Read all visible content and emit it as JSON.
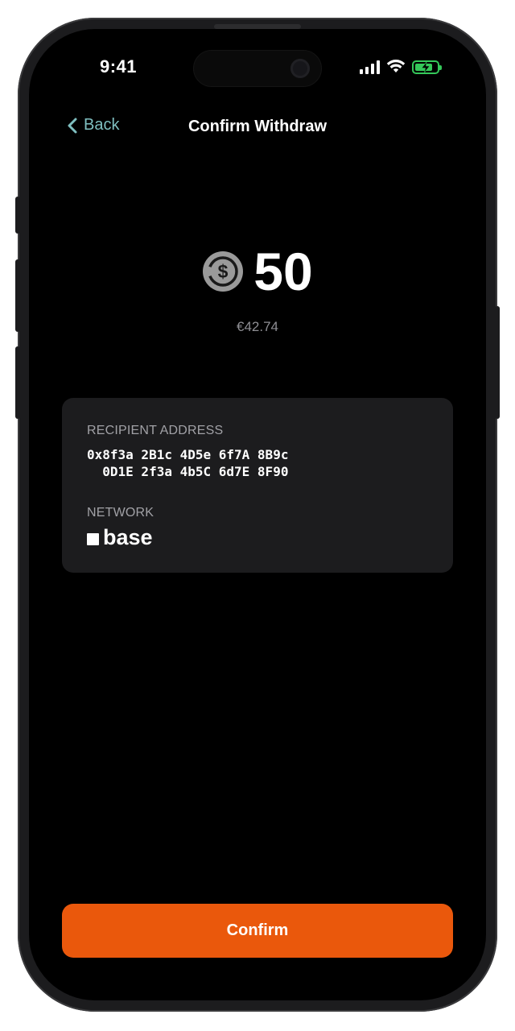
{
  "status_bar": {
    "time": "9:41",
    "icons": [
      "signal-icon",
      "wifi-icon",
      "battery-charging-icon"
    ],
    "battery_color": "#34c759"
  },
  "nav": {
    "back_label": "Back",
    "title": "Confirm Withdraw",
    "accent_color": "#7fbfc0"
  },
  "amount": {
    "value": "50",
    "token_icon": "usdc-coin-icon",
    "fiat": "€42.74"
  },
  "details": {
    "recipient_label": "RECIPIENT ADDRESS",
    "recipient_line1": "0x8f3a 2B1c 4D5e 6f7A 8B9c",
    "recipient_line2": "  0D1E 2f3a 4b5C 6d7E 8F90",
    "network_label": "NETWORK",
    "network_name": "base"
  },
  "actions": {
    "confirm_label": "Confirm",
    "confirm_color": "#ea580c"
  }
}
